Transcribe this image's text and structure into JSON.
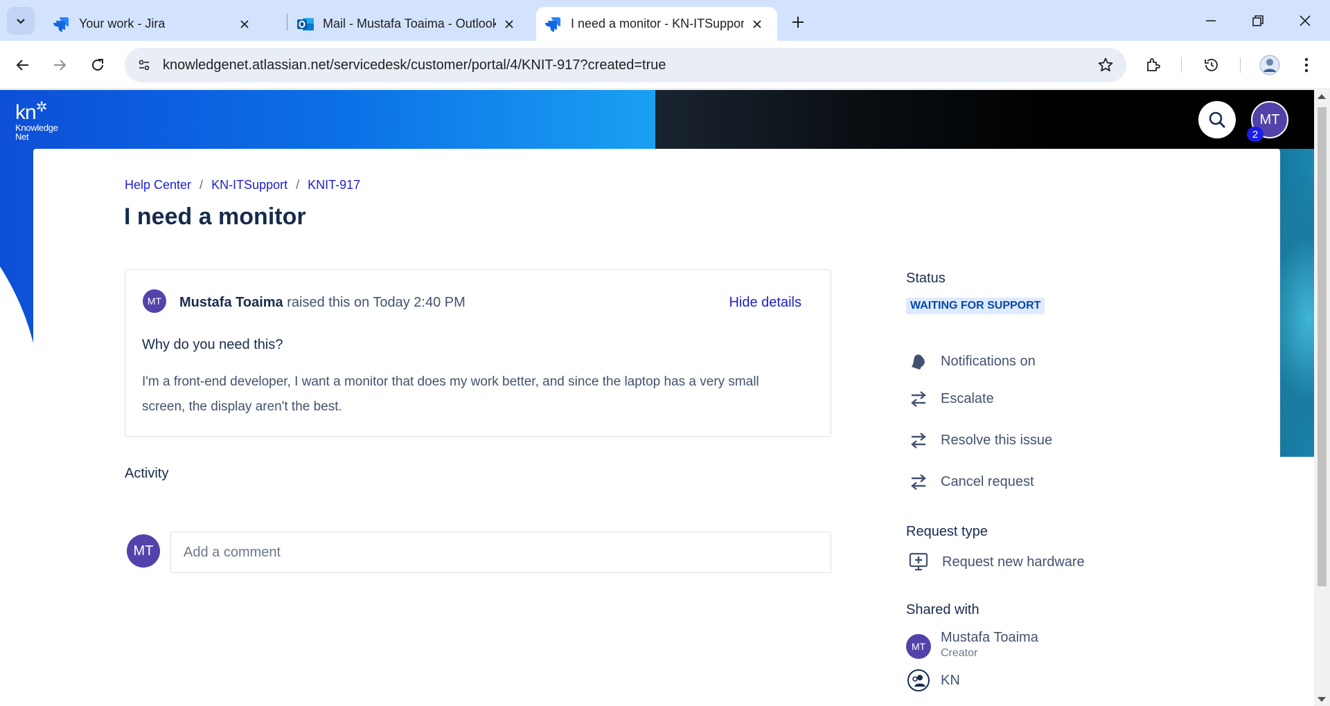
{
  "browser": {
    "tabs": [
      {
        "title": "Your work - Jira",
        "icon": "jira-icon",
        "active": false
      },
      {
        "title": "Mail - Mustafa Toaima - Outlook",
        "icon": "outlook-icon",
        "active": false
      },
      {
        "title": "I need a monitor - KN-ITSupport",
        "icon": "jira-icon",
        "active": true
      }
    ],
    "url": "knowledgenet.atlassian.net/servicedesk/customer/portal/4/KNIT-917?created=true"
  },
  "header": {
    "logo_mark": "kn",
    "logo_line1": "Knowledge",
    "logo_line2": "Net",
    "avatar_initials": "MT",
    "notification_count": "2"
  },
  "breadcrumb": {
    "items": [
      "Help Center",
      "KN-ITSupport",
      "KNIT-917"
    ]
  },
  "request": {
    "title": "I need a monitor",
    "reporter_initials": "MT",
    "reporter_name": "Mustafa Toaima",
    "raised_text": "raised this on Today 2:40 PM",
    "hide_details_label": "Hide details",
    "question": "Why do you need this?",
    "answer": "I'm a front-end developer, I want a monitor that does my work better, and since the laptop has a very small screen, the display aren't the best."
  },
  "activity": {
    "heading": "Activity",
    "avatar_initials": "MT",
    "comment_placeholder": "Add a comment"
  },
  "sidebar": {
    "status_label": "Status",
    "status_value": "WAITING FOR SUPPORT",
    "actions": [
      {
        "label": "Notifications on",
        "icon": "bell-icon"
      },
      {
        "label": "Escalate",
        "icon": "transition-arrows-icon"
      },
      {
        "label": "Resolve this issue",
        "icon": "transition-arrows-icon"
      },
      {
        "label": "Cancel request",
        "icon": "transition-arrows-icon"
      }
    ],
    "request_type_label": "Request type",
    "request_type_value": "Request new hardware",
    "shared_with_label": "Shared with",
    "shared": [
      {
        "initials": "MT",
        "name": "Mustafa Toaima",
        "role": "Creator"
      },
      {
        "name": "KN",
        "icon": "organization-icon"
      }
    ]
  },
  "colors": {
    "link": "#1d1dcf",
    "avatar": "#5243aa",
    "status_bg": "#deebff",
    "status_text": "#0747a6"
  }
}
